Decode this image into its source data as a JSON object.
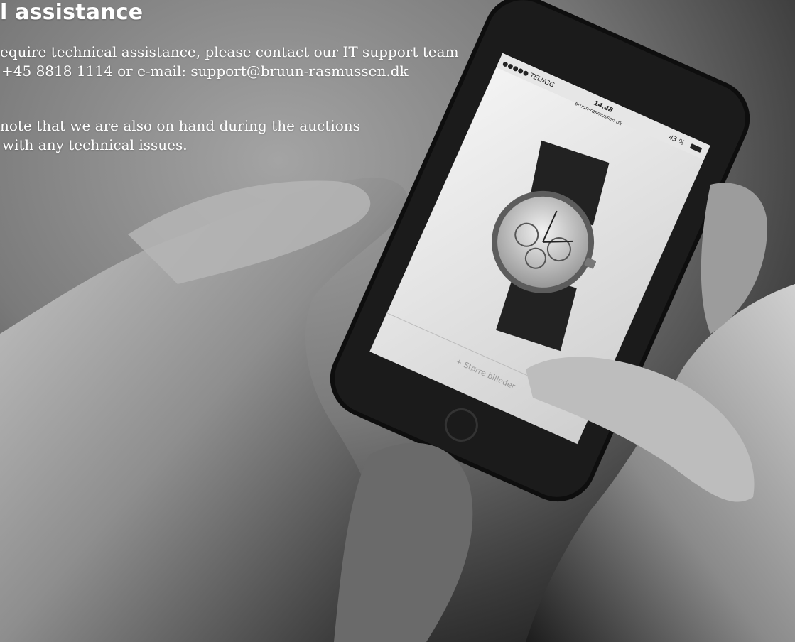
{
  "heading": "l assistance",
  "paragraphs": [
    {
      "lines": [
        "equire technical assistance, please contact our IT support team",
        "+45 8818 1114 or e-mail: support@bruun-rasmussen.dk"
      ]
    },
    {
      "lines": [
        "note that we are also on hand during the auctions",
        "with any technical issues."
      ]
    }
  ],
  "phone_screen": {
    "carrier": "●●●●● TELIA",
    "network": "3G",
    "time": "14.48",
    "url": "bruun-rasmussen.dk",
    "battery": "43 %",
    "bid_button": "+ Større billeder"
  }
}
